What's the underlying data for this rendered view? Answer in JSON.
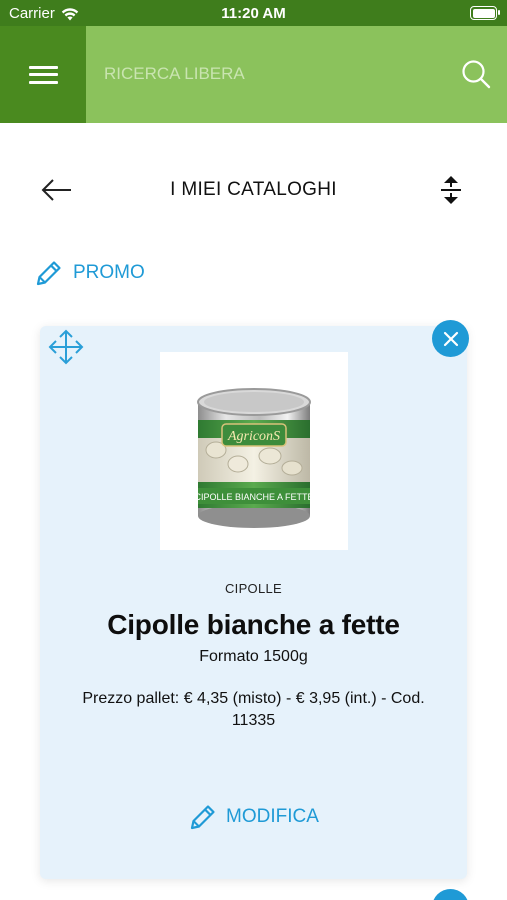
{
  "status_bar": {
    "carrier": "Carrier",
    "time": "11:20 AM"
  },
  "header": {
    "search_placeholder": "RICERCA LIBERA",
    "menu_icon": "hamburger-menu-icon",
    "search_icon": "magnifier-icon"
  },
  "page": {
    "title": "I MIEI CATALOGHI"
  },
  "catalog": {
    "name": "PROMO"
  },
  "product_card": {
    "category": "CIPOLLE",
    "name": "Cipolle bianche a fette",
    "format": "Formato 1500g",
    "price_line": "Prezzo pallet: € 4,35 (misto) - € 3,95 (int.) - Cod. 11335",
    "edit_label": "MODIFICA",
    "image": {
      "brand_text": "AgriconS",
      "can_label_text": "CIPOLLE BIANCHE A FETTE"
    }
  },
  "colors": {
    "status_bar": "#3f7d1c",
    "header": "#8bc25c",
    "menu_button": "#4a8a1f",
    "accent_blue": "#1f9ad6",
    "card_background": "#e6f2fb"
  }
}
